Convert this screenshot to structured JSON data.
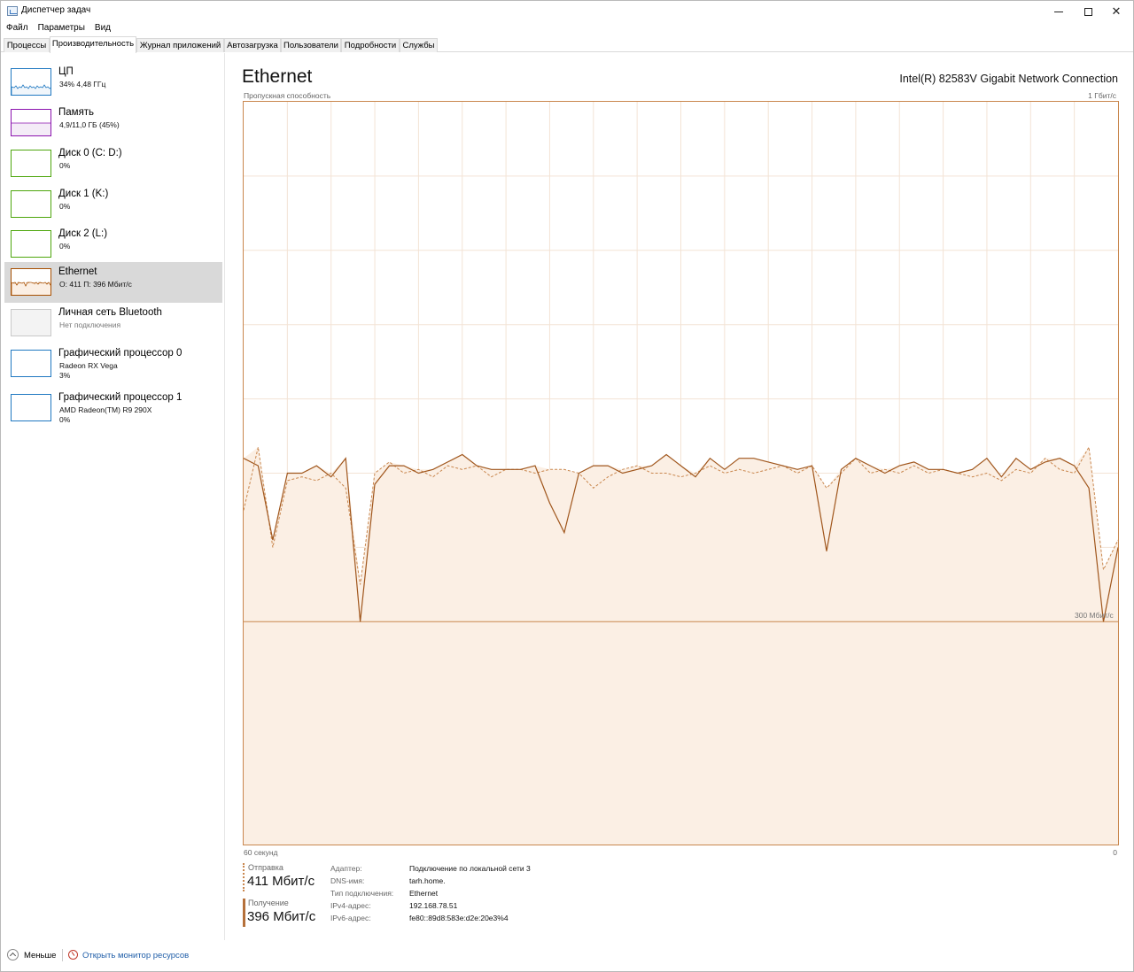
{
  "window": {
    "title": "Диспетчер задач",
    "controls": {
      "minimize": "minimize-icon",
      "maximize": "maximize-icon",
      "close": "close-icon"
    }
  },
  "menu": {
    "file": "Файл",
    "options": "Параметры",
    "view": "Вид"
  },
  "tabs": [
    {
      "label": "Процессы"
    },
    {
      "label": "Производительность",
      "active": true
    },
    {
      "label": "Журнал приложений"
    },
    {
      "label": "Автозагрузка"
    },
    {
      "label": "Пользователи"
    },
    {
      "label": "Подробности"
    },
    {
      "label": "Службы"
    }
  ],
  "sidebar": {
    "items": [
      {
        "name": "ЦП",
        "sub": "34% 4,48 ГГц",
        "color": "#1f78c1"
      },
      {
        "name": "Память",
        "sub": "4,9/11,0 ГБ (45%)",
        "color": "#8b12ae"
      },
      {
        "name": "Диск 0 (C: D:)",
        "sub": "0%",
        "color": "#4da60c"
      },
      {
        "name": "Диск 1 (K:)",
        "sub": "0%",
        "color": "#4da60c"
      },
      {
        "name": "Диск 2 (L:)",
        "sub": "0%",
        "color": "#4da60c"
      },
      {
        "name": "Ethernet",
        "sub": "О: 411 П: 396 Мбит/с",
        "color": "#a74f01",
        "selected": true
      },
      {
        "name": "Личная сеть Bluetooth",
        "sub": "Нет подключения",
        "color": "#c8c8c8"
      },
      {
        "name": "Графический процессор 0",
        "sub": "Radeon RX Vega",
        "sub2": "3%",
        "color": "#1f78c1"
      },
      {
        "name": "Графический процессор 1",
        "sub": "AMD Radeon(TM) R9 290X",
        "sub2": "0%",
        "color": "#1f78c1"
      }
    ]
  },
  "main": {
    "title": "Ethernet",
    "adapter": "Intel(R) 82583V Gigabit Network Connection",
    "capacity_label": "Пропускная способность",
    "capacity_max": "1 Гбит/с",
    "time_left": "60 секунд",
    "time_right": "0",
    "marker_label": "300 Мбит/с"
  },
  "chart_data": {
    "type": "line",
    "x_label": "60 секунд",
    "y_max_label": "1 Гбит/с",
    "ylim": [
      0,
      1000
    ],
    "y_unit": "Мбит/с",
    "x": [
      60,
      59,
      58,
      57,
      56,
      55,
      54,
      53,
      52,
      51,
      50,
      49,
      48,
      47,
      46,
      45,
      44,
      43,
      42,
      41,
      40,
      39,
      38,
      37,
      36,
      35,
      34,
      33,
      32,
      31,
      30,
      29,
      28,
      27,
      26,
      25,
      24,
      23,
      22,
      21,
      20,
      19,
      18,
      17,
      16,
      15,
      14,
      13,
      12,
      11,
      10,
      9,
      8,
      7,
      6,
      5,
      4,
      3,
      2,
      1,
      0
    ],
    "reference_line": {
      "label": "300 Мбит/с",
      "value": 300
    },
    "series": [
      {
        "name": "Отправка",
        "style": "dashed",
        "color": "#c9874e",
        "values": [
          450,
          535,
          400,
          490,
          495,
          490,
          500,
          480,
          350,
          500,
          515,
          500,
          505,
          495,
          510,
          505,
          510,
          495,
          505,
          505,
          500,
          505,
          505,
          500,
          480,
          495,
          505,
          510,
          500,
          500,
          495,
          500,
          510,
          500,
          505,
          500,
          505,
          510,
          500,
          510,
          480,
          500,
          520,
          500,
          505,
          500,
          510,
          500,
          505,
          500,
          495,
          500,
          490,
          505,
          500,
          520,
          505,
          500,
          535,
          370,
          410
        ]
      },
      {
        "name": "Получение",
        "style": "solid",
        "color": "#a0561c",
        "values": [
          520,
          510,
          410,
          500,
          500,
          510,
          495,
          520,
          300,
          485,
          510,
          510,
          500,
          505,
          515,
          525,
          510,
          505,
          505,
          505,
          510,
          460,
          420,
          500,
          510,
          510,
          500,
          505,
          510,
          525,
          510,
          495,
          520,
          505,
          520,
          520,
          515,
          510,
          505,
          510,
          395,
          505,
          520,
          510,
          500,
          510,
          515,
          505,
          505,
          500,
          505,
          520,
          495,
          520,
          505,
          515,
          520,
          510,
          480,
          300,
          400
        ]
      }
    ]
  },
  "stats": {
    "send_label": "Отправка",
    "send_value": "411 Мбит/с",
    "recv_label": "Получение",
    "recv_value": "396 Мбит/с",
    "info": [
      {
        "label": "Адаптер:",
        "value": "Подключение по локальной сети 3"
      },
      {
        "label": "DNS-имя:",
        "value": "tarh.home."
      },
      {
        "label": "Тип подключения:",
        "value": "Ethernet"
      },
      {
        "label": "IPv4-адрес:",
        "value": "192.168.78.51"
      },
      {
        "label": "IPv6-адрес:",
        "value": "fe80::89d8:583e:d2e:20e3%4"
      }
    ]
  },
  "footer": {
    "less": "Меньше",
    "monitor": "Открыть монитор ресурсов"
  }
}
